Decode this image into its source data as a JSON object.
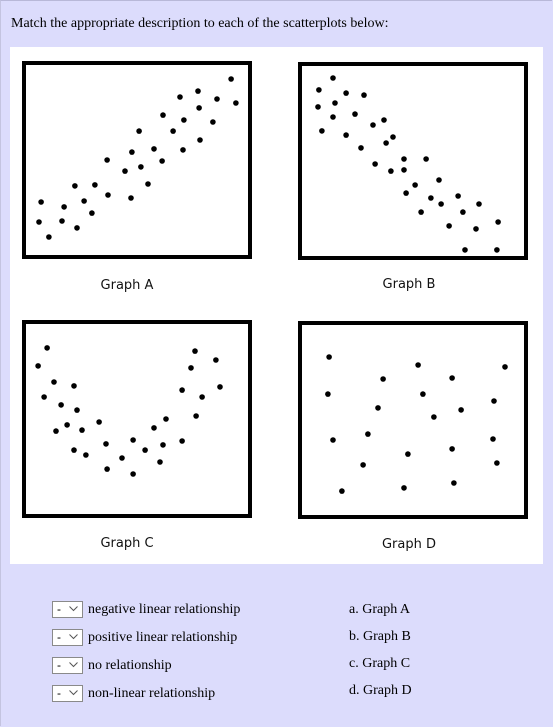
{
  "question": {
    "prompt": "Match the appropriate description to each of the scatterplots below:"
  },
  "chart_data": [
    {
      "type": "scatter",
      "title": "Graph A",
      "xlabel": "",
      "ylabel": "",
      "xlim": [
        0,
        100
      ],
      "ylim": [
        0,
        100
      ],
      "grid": false,
      "points": [
        [
          8.3,
          28.8
        ],
        [
          7.4,
          18.7
        ],
        [
          11.7,
          11.1
        ],
        [
          18.3,
          26.3
        ],
        [
          17.4,
          19.2
        ],
        [
          23.9,
          15.7
        ],
        [
          23.0,
          36.9
        ],
        [
          27.0,
          29.3
        ],
        [
          30.4,
          23.2
        ],
        [
          31.7,
          37.4
        ],
        [
          37.0,
          50.0
        ],
        [
          37.4,
          32.3
        ],
        [
          44.8,
          44.4
        ],
        [
          47.4,
          30.8
        ],
        [
          47.8,
          54.0
        ],
        [
          51.7,
          46.5
        ],
        [
          50.9,
          64.6
        ],
        [
          54.8,
          37.9
        ],
        [
          57.4,
          55.6
        ],
        [
          60.9,
          49.5
        ],
        [
          61.3,
          72.7
        ],
        [
          65.7,
          64.6
        ],
        [
          68.7,
          81.8
        ],
        [
          70.4,
          70.2
        ],
        [
          70.0,
          55.1
        ],
        [
          76.5,
          84.8
        ],
        [
          77.0,
          76.3
        ],
        [
          77.4,
          60.1
        ],
        [
          83.0,
          69.2
        ],
        [
          84.8,
          80.8
        ],
        [
          90.9,
          90.9
        ],
        [
          93.0,
          78.8
        ]
      ]
    },
    {
      "type": "scatter",
      "title": "Graph B",
      "xlabel": "",
      "ylabel": "",
      "xlim": [
        0,
        100
      ],
      "ylim": [
        0,
        100
      ],
      "grid": false,
      "points": [
        [
          15.2,
          91.9
        ],
        [
          9.1,
          85.9
        ],
        [
          20.9,
          84.3
        ],
        [
          28.7,
          83.3
        ],
        [
          16.1,
          79.3
        ],
        [
          8.7,
          77.3
        ],
        [
          15.2,
          72.2
        ],
        [
          24.8,
          73.7
        ],
        [
          10.4,
          65.2
        ],
        [
          20.9,
          63.1
        ],
        [
          32.6,
          68.2
        ],
        [
          37.4,
          70.7
        ],
        [
          41.3,
          62.1
        ],
        [
          38.3,
          59.1
        ],
        [
          27.4,
          56.6
        ],
        [
          33.5,
          48.5
        ],
        [
          46.1,
          51.0
        ],
        [
          55.7,
          51.0
        ],
        [
          40.4,
          44.9
        ],
        [
          46.1,
          45.5
        ],
        [
          61.3,
          40.4
        ],
        [
          50.9,
          37.9
        ],
        [
          47.0,
          33.8
        ],
        [
          57.8,
          31.3
        ],
        [
          62.2,
          28.3
        ],
        [
          69.6,
          32.3
        ],
        [
          78.7,
          28.3
        ],
        [
          53.5,
          24.2
        ],
        [
          71.7,
          24.2
        ],
        [
          65.7,
          17.2
        ],
        [
          77.4,
          15.7
        ],
        [
          87.0,
          19.2
        ],
        [
          72.6,
          5.1
        ],
        [
          86.5,
          5.1
        ]
      ]
    },
    {
      "type": "scatter",
      "title": "Graph C",
      "xlabel": "",
      "ylabel": "",
      "xlim": [
        0,
        100
      ],
      "ylim": [
        0,
        100
      ],
      "grid": false,
      "points": [
        [
          10.9,
          85.9
        ],
        [
          7.0,
          76.8
        ],
        [
          13.9,
          68.7
        ],
        [
          22.6,
          66.7
        ],
        [
          9.6,
          61.1
        ],
        [
          17.0,
          57.1
        ],
        [
          23.9,
          54.5
        ],
        [
          19.6,
          47.0
        ],
        [
          14.8,
          43.9
        ],
        [
          26.1,
          44.4
        ],
        [
          33.5,
          48.5
        ],
        [
          22.6,
          34.3
        ],
        [
          27.8,
          31.8
        ],
        [
          36.5,
          37.4
        ],
        [
          37.0,
          24.7
        ],
        [
          43.5,
          30.3
        ],
        [
          48.3,
          39.4
        ],
        [
          48.3,
          22.2
        ],
        [
          53.5,
          34.3
        ],
        [
          60.0,
          28.3
        ],
        [
          61.3,
          36.9
        ],
        [
          57.4,
          45.5
        ],
        [
          62.6,
          50.0
        ],
        [
          69.6,
          38.9
        ],
        [
          69.6,
          64.6
        ],
        [
          75.7,
          51.5
        ],
        [
          78.3,
          61.1
        ],
        [
          73.5,
          75.8
        ],
        [
          75.2,
          84.3
        ],
        [
          84.3,
          79.8
        ],
        [
          86.1,
          66.2
        ]
      ]
    },
    {
      "type": "scatter",
      "title": "Graph D",
      "xlabel": "",
      "ylabel": "",
      "xlim": [
        0,
        100
      ],
      "ylim": [
        0,
        100
      ],
      "grid": false,
      "points": [
        [
          13.5,
          81.8
        ],
        [
          13.0,
          63.1
        ],
        [
          15.2,
          39.9
        ],
        [
          19.1,
          14.1
        ],
        [
          28.3,
          27.3
        ],
        [
          30.4,
          42.9
        ],
        [
          34.8,
          56.1
        ],
        [
          37.0,
          70.7
        ],
        [
          46.1,
          15.7
        ],
        [
          47.8,
          32.8
        ],
        [
          52.2,
          77.8
        ],
        [
          54.3,
          63.1
        ],
        [
          59.1,
          51.5
        ],
        [
          67.0,
          71.2
        ],
        [
          70.9,
          55.1
        ],
        [
          67.0,
          35.4
        ],
        [
          67.8,
          18.2
        ],
        [
          85.2,
          59.6
        ],
        [
          84.8,
          40.4
        ],
        [
          86.5,
          28.3
        ],
        [
          90.0,
          76.8
        ]
      ]
    }
  ],
  "matching": {
    "items": [
      {
        "select_value": "-",
        "description": "negative linear relationship"
      },
      {
        "select_value": "-",
        "description": "positive linear relationship"
      },
      {
        "select_value": "-",
        "description": "no relationship"
      },
      {
        "select_value": "-",
        "description": "non-linear relationship"
      }
    ],
    "options": [
      "a. Graph A",
      "b. Graph B",
      "c. Graph C",
      "d. Graph D"
    ],
    "select_icon": "chevron-down-icon"
  }
}
